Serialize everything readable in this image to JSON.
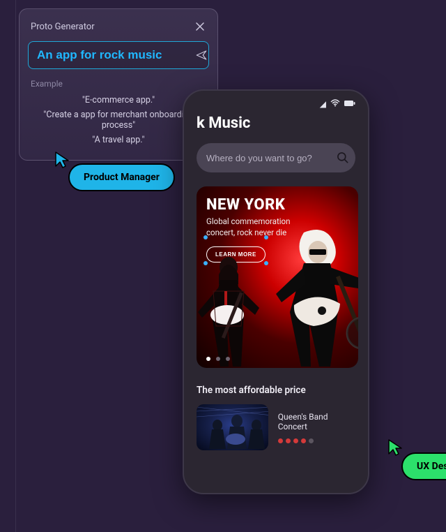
{
  "proto": {
    "title": "Proto Generator",
    "input_value": "An app for rock music",
    "example_label": "Example",
    "examples": [
      "\"E-commerce app.\"",
      "\"Create a app for merchant onboarding process\"",
      "\"A travel app.\""
    ]
  },
  "badges": {
    "pm": "Product Manager",
    "ux": "UX Desi"
  },
  "app": {
    "title_visible": "k Music",
    "search_placeholder": "Where do you want to go?",
    "hero": {
      "city": "NEW YORK",
      "subtitle": "Global commemoration concert, rock never die",
      "button": "LEARN MORE"
    },
    "section_title": "The most affordable price",
    "price_item": {
      "name": "Queen's Band Concert",
      "rating_filled": 4,
      "rating_total": 5
    }
  },
  "colors": {
    "accent_cyan": "#1fb4e8",
    "accent_text": "#20b8ff",
    "ux_green": "#2ce06b"
  }
}
